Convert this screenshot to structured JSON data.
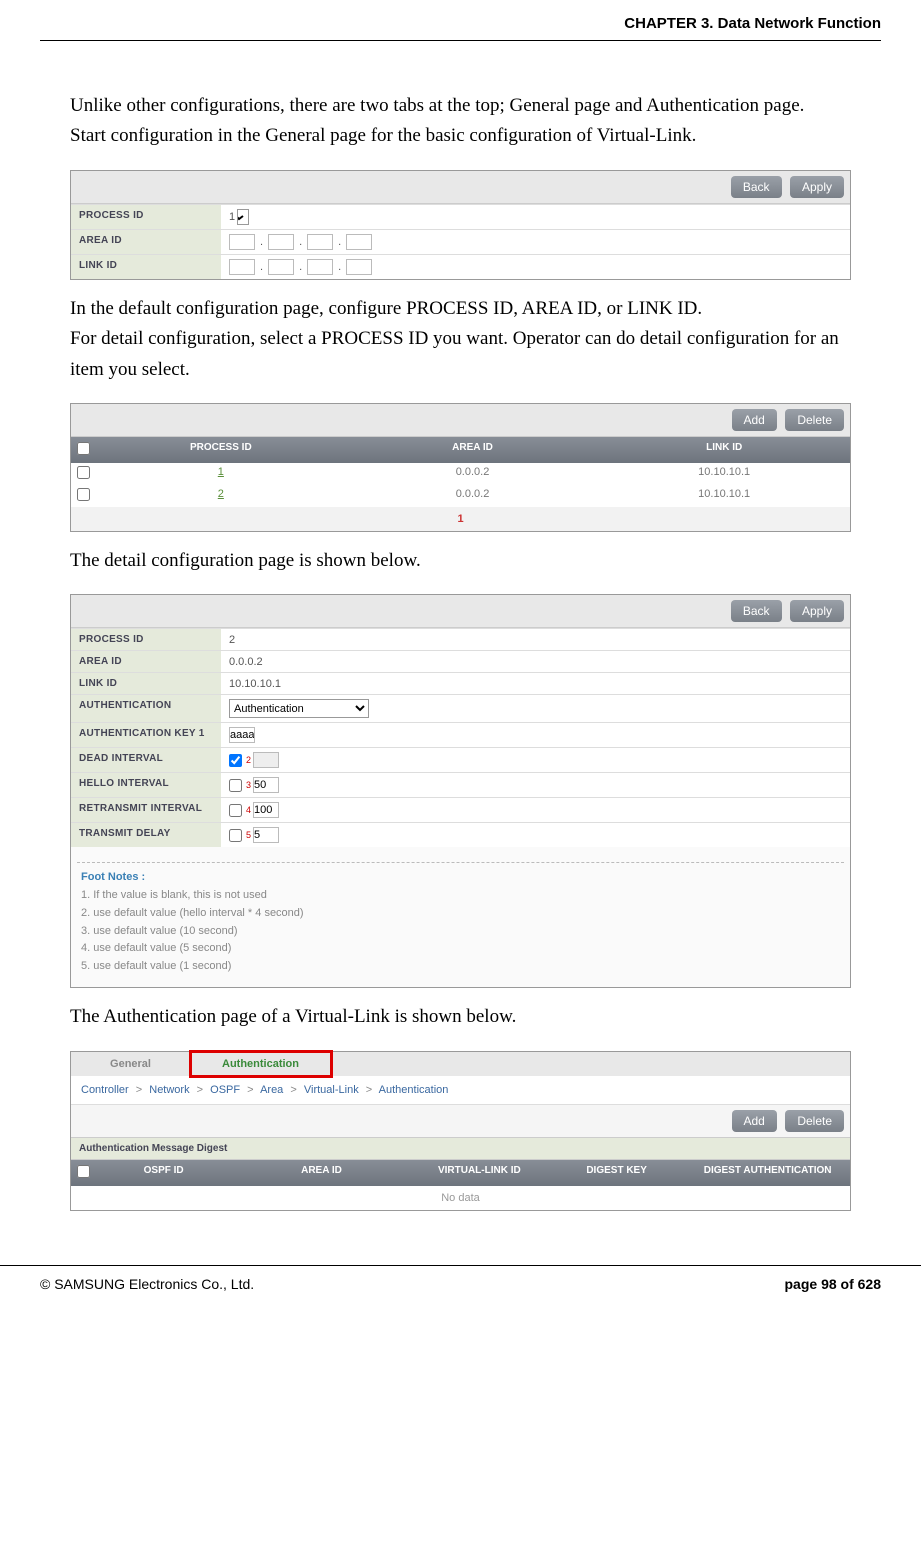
{
  "header": {
    "chapter": "CHAPTER 3. Data Network Function"
  },
  "text": {
    "p1": "Unlike other configurations, there are two tabs at the top; General page and Authentication page.",
    "p1b": "Start configuration in the General page for the basic configuration of Virtual-Link.",
    "p2": "In the default configuration page, configure PROCESS ID, AREA ID, or LINK ID.",
    "p2b": "For detail configuration, select a PROCESS ID you want. Operator can do detail configuration for an item you select.",
    "p3": "The detail configuration page is shown below.",
    "p4": "The Authentication page of a Virtual-Link is shown below."
  },
  "buttons": {
    "back": "Back",
    "apply": "Apply",
    "add": "Add",
    "delete": "Delete"
  },
  "panel1": {
    "labels": {
      "process_id": "PROCESS ID",
      "area_id": "AREA ID",
      "link_id": "LINK ID"
    },
    "process_id_value": "1"
  },
  "panel2": {
    "headers": {
      "process_id": "PROCESS ID",
      "area_id": "AREA ID",
      "link_id": "LINK ID"
    },
    "rows": [
      {
        "pid": "1",
        "area": "0.0.0.2",
        "link": "10.10.10.1"
      },
      {
        "pid": "2",
        "area": "0.0.0.2",
        "link": "10.10.10.1"
      }
    ],
    "page": "1"
  },
  "panel3": {
    "labels": {
      "process_id": "PROCESS ID",
      "area_id": "AREA ID",
      "link_id": "LINK ID",
      "authentication": "AUTHENTICATION",
      "auth_key": "AUTHENTICATION KEY",
      "dead": "DEAD INTERVAL",
      "hello": "HELLO INTERVAL",
      "retransmit": "RETRANSMIT INTERVAL",
      "transmit": "TRANSMIT DELAY"
    },
    "values": {
      "process_id": "2",
      "area_id": "0.0.0.2",
      "link_id": "10.10.10.1",
      "auth_select": "Authentication",
      "auth_key": "aaaaaaaa",
      "hello": "50",
      "retransmit": "100",
      "transmit": "5"
    },
    "sup": {
      "auth_key": "1",
      "dead": "2",
      "hello": "3",
      "retransmit": "4",
      "transmit": "5"
    },
    "footnotes": {
      "title": "Foot Notes :",
      "fn1": "1. If the value is blank, this is not used",
      "fn2": "2. use default value (hello interval * 4 second)",
      "fn3": "3. use default value (10 second)",
      "fn4": "4. use default value (5 second)",
      "fn5": "5. use default value (1 second)"
    }
  },
  "panel4": {
    "tabs": {
      "general": "General",
      "auth": "Authentication"
    },
    "crumb": {
      "c1": "Controller",
      "c2": "Network",
      "c3": "OSPF",
      "c4": "Area",
      "c5": "Virtual-Link",
      "c6": "Authentication",
      "sep": ">"
    },
    "section": "Authentication Message Digest",
    "headers": {
      "ospf": "OSPF ID",
      "area": "AREA ID",
      "vlink": "VIRTUAL-LINK ID",
      "digest": "DIGEST KEY",
      "dauth": "DIGEST AUTHENTICATION"
    },
    "nodata": "No data"
  },
  "footer": {
    "left": "© SAMSUNG Electronics Co., Ltd.",
    "right": "page 98 of 628"
  }
}
